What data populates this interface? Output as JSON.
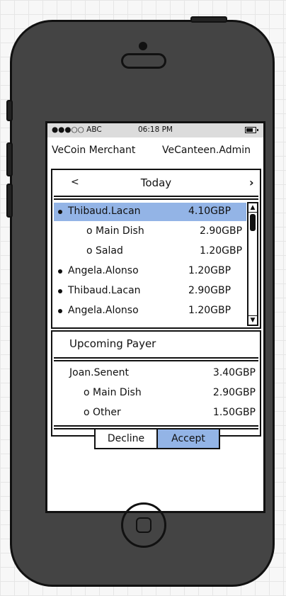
{
  "status_bar": {
    "signal": "●●●○○ ABC",
    "time": "06:18 PM"
  },
  "header": {
    "left_label": "VeCoin Merchant",
    "right_label": "VeCanteen.Admin"
  },
  "day_nav": {
    "prev": "<",
    "title": "Today",
    "next": "›"
  },
  "today_list": [
    {
      "name": "Thibaud.Lacan",
      "amount": "4.10GBP",
      "selected": true,
      "level": 0
    },
    {
      "name": "o Main Dish",
      "amount": "2.90GBP",
      "selected": false,
      "level": 1
    },
    {
      "name": "o Salad",
      "amount": "1.20GBP",
      "selected": false,
      "level": 1
    },
    {
      "name": "Angela.Alonso",
      "amount": "1.20GBP",
      "selected": false,
      "level": 0
    },
    {
      "name": "Thibaud.Lacan",
      "amount": "2.90GBP",
      "selected": false,
      "level": 0
    },
    {
      "name": "Angela.Alonso",
      "amount": "1.20GBP",
      "selected": false,
      "level": 0
    }
  ],
  "scrollbar": {
    "up": "▲",
    "down": "▼"
  },
  "upcoming": {
    "title": "Upcoming Payer",
    "rows": [
      {
        "name": "Joan.Senent",
        "amount": "3.40GBP",
        "level": 0
      },
      {
        "name": "o Main Dish",
        "amount": "2.90GBP",
        "level": 1
      },
      {
        "name": "o Other",
        "amount": "1.50GBP",
        "level": 1
      }
    ]
  },
  "actions": {
    "decline": "Decline",
    "accept": "Accept"
  },
  "colors": {
    "selection": "#93b4e6",
    "phone_body": "#444444"
  }
}
